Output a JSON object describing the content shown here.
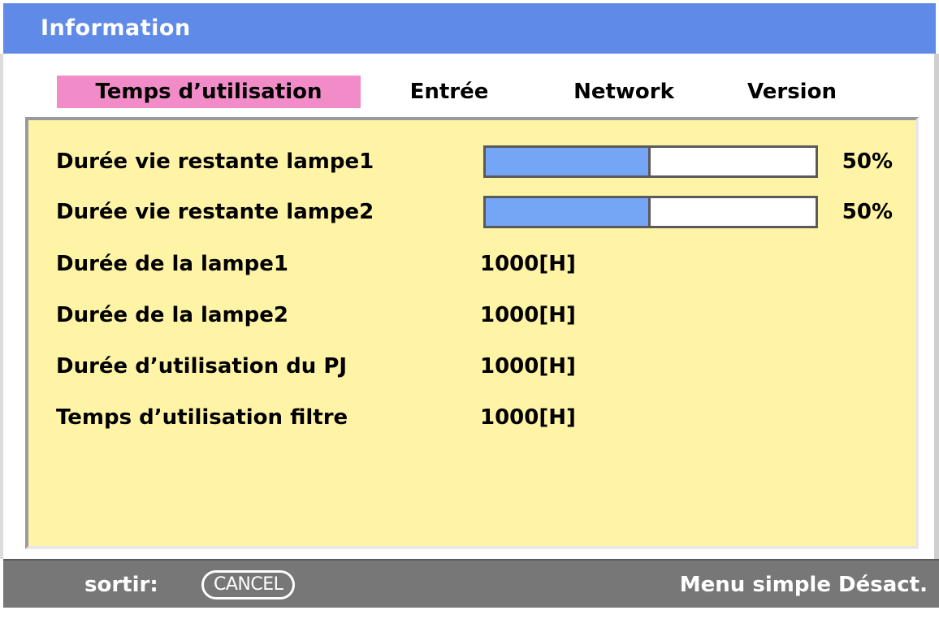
{
  "window": {
    "title": "Information"
  },
  "tabs": [
    {
      "label": "Temps d’utilisation",
      "active": true
    },
    {
      "label": "Entrée",
      "active": false
    },
    {
      "label": "Network",
      "active": false
    },
    {
      "label": "Version",
      "active": false
    }
  ],
  "rows": [
    {
      "label": "Durée vie restante lampe1",
      "type": "bar",
      "percent": 50,
      "percent_text": "50%"
    },
    {
      "label": "Durée vie restante lampe2",
      "type": "bar",
      "percent": 50,
      "percent_text": "50%"
    },
    {
      "label": "Durée de la lampe1",
      "type": "text",
      "value": "1000[H]"
    },
    {
      "label": "Durée de la lampe2",
      "type": "text",
      "value": "1000[H]"
    },
    {
      "label": "Durée d’utilisation du PJ",
      "type": "text",
      "value": "1000[H]"
    },
    {
      "label": "Temps d’utilisation filtre",
      "type": "text",
      "value": "1000[H]"
    }
  ],
  "footer": {
    "exit_label": "sortir:",
    "cancel_key": "CANCEL",
    "status": "Menu simple Désact."
  },
  "colors": {
    "titlebar": "#5f8ae8",
    "active_tab": "#f28cc8",
    "panel": "#fff3a6",
    "bar_fill": "#74a6f5",
    "footer": "#777777"
  }
}
